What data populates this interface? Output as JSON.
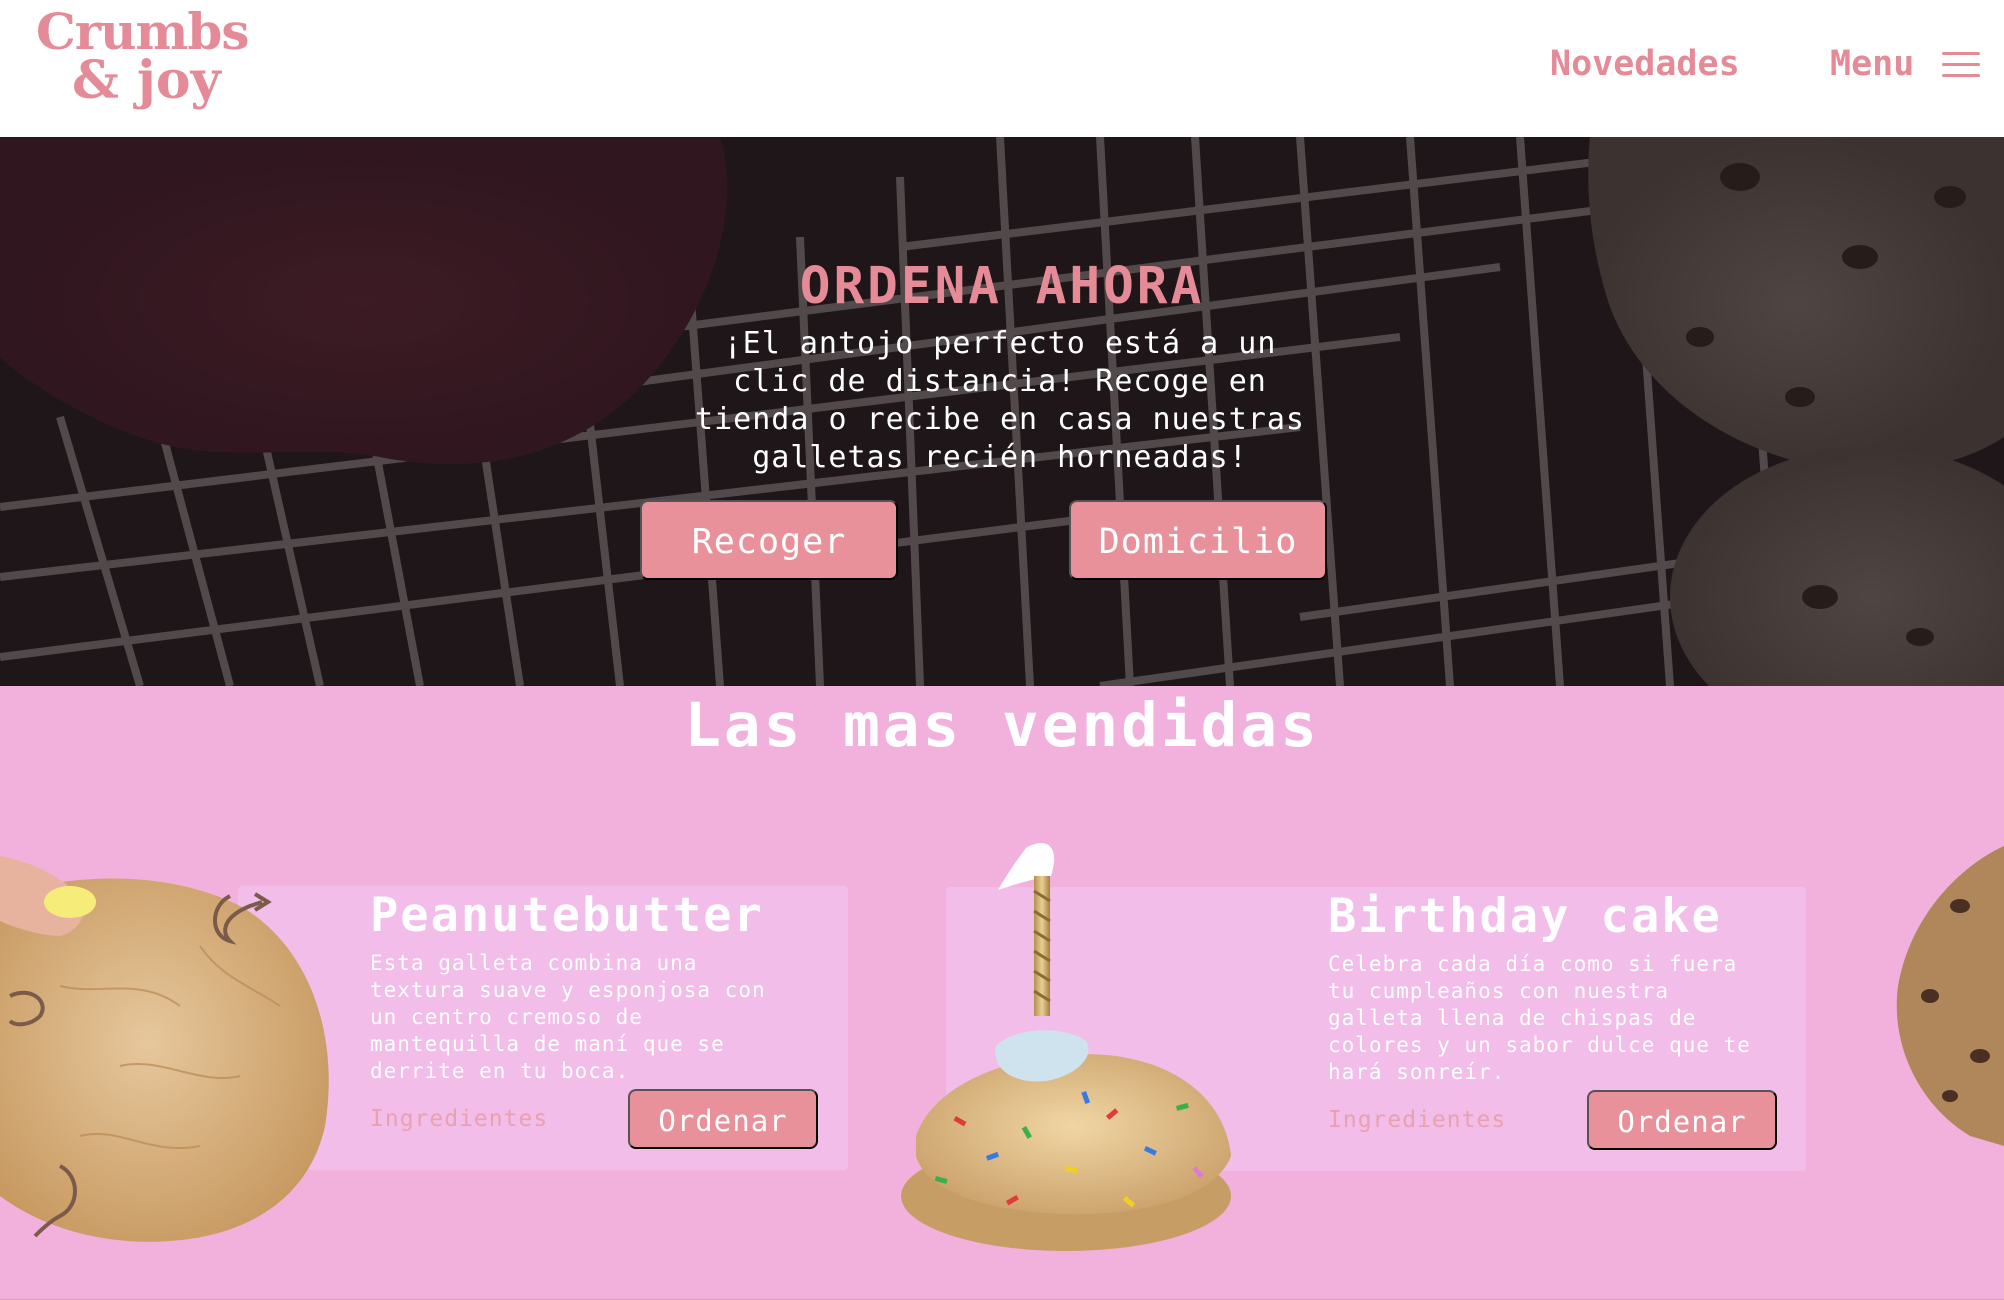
{
  "header": {
    "logo_line1": "Crumbs",
    "logo_line2": "& joy",
    "nav": {
      "novedades": "Novedades",
      "menu": "Menu"
    },
    "menu_icon": "hamburger-icon"
  },
  "hero": {
    "title": "ORDENA AHORA",
    "text": "¡El antojo perfecto está a un clic de distancia! Recoge en tienda o recibe en casa nuestras galletas recién horneadas!",
    "buttons": {
      "pickup": "Recoger",
      "delivery": "Domicilio"
    }
  },
  "bestsellers": {
    "title": "Las mas vendidas",
    "products": [
      {
        "name": "Peanutebutter",
        "description": "Esta galleta combina una textura suave y esponjosa con un centro cremoso de mantequilla de maní que se derrite en tu boca.",
        "ingredients_label": "Ingredientes",
        "order_label": "Ordenar"
      },
      {
        "name": "Birthday cake",
        "description": "Celebra cada día como si fuera tu cumpleaños con nuestra galleta llena de chispas de colores y un sabor dulce que te hará sonreír.",
        "ingredients_label": "Ingredientes",
        "order_label": "Ordenar"
      }
    ]
  },
  "colors": {
    "brand_pink": "#e58a97",
    "button_pink": "#e8919b",
    "section_bg": "#f2b1dc",
    "card_bg": "#f2bde9",
    "hero_bg": "#2c1e22"
  }
}
